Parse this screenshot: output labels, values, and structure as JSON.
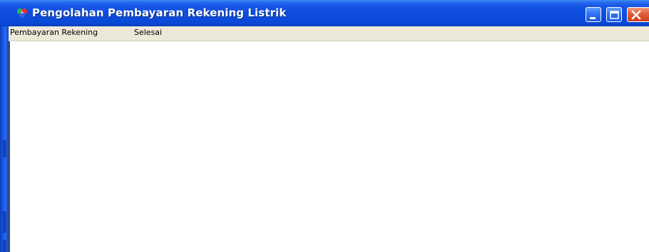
{
  "window": {
    "title": "Pengolahan Pembayaran Rekening Listrik",
    "icon": "app-icon",
    "controls": {
      "minimize_icon": "minimize-icon",
      "maximize_icon": "maximize-icon",
      "close_icon": "close-icon"
    },
    "colors": {
      "titlebar": "#0c4bdc",
      "close_button": "#e3603c",
      "menubar": "#ece9d8",
      "client": "#ffffff"
    }
  },
  "menubar": {
    "items": [
      {
        "label": "Pembayaran Rekening"
      },
      {
        "label": "Selesai"
      }
    ]
  }
}
